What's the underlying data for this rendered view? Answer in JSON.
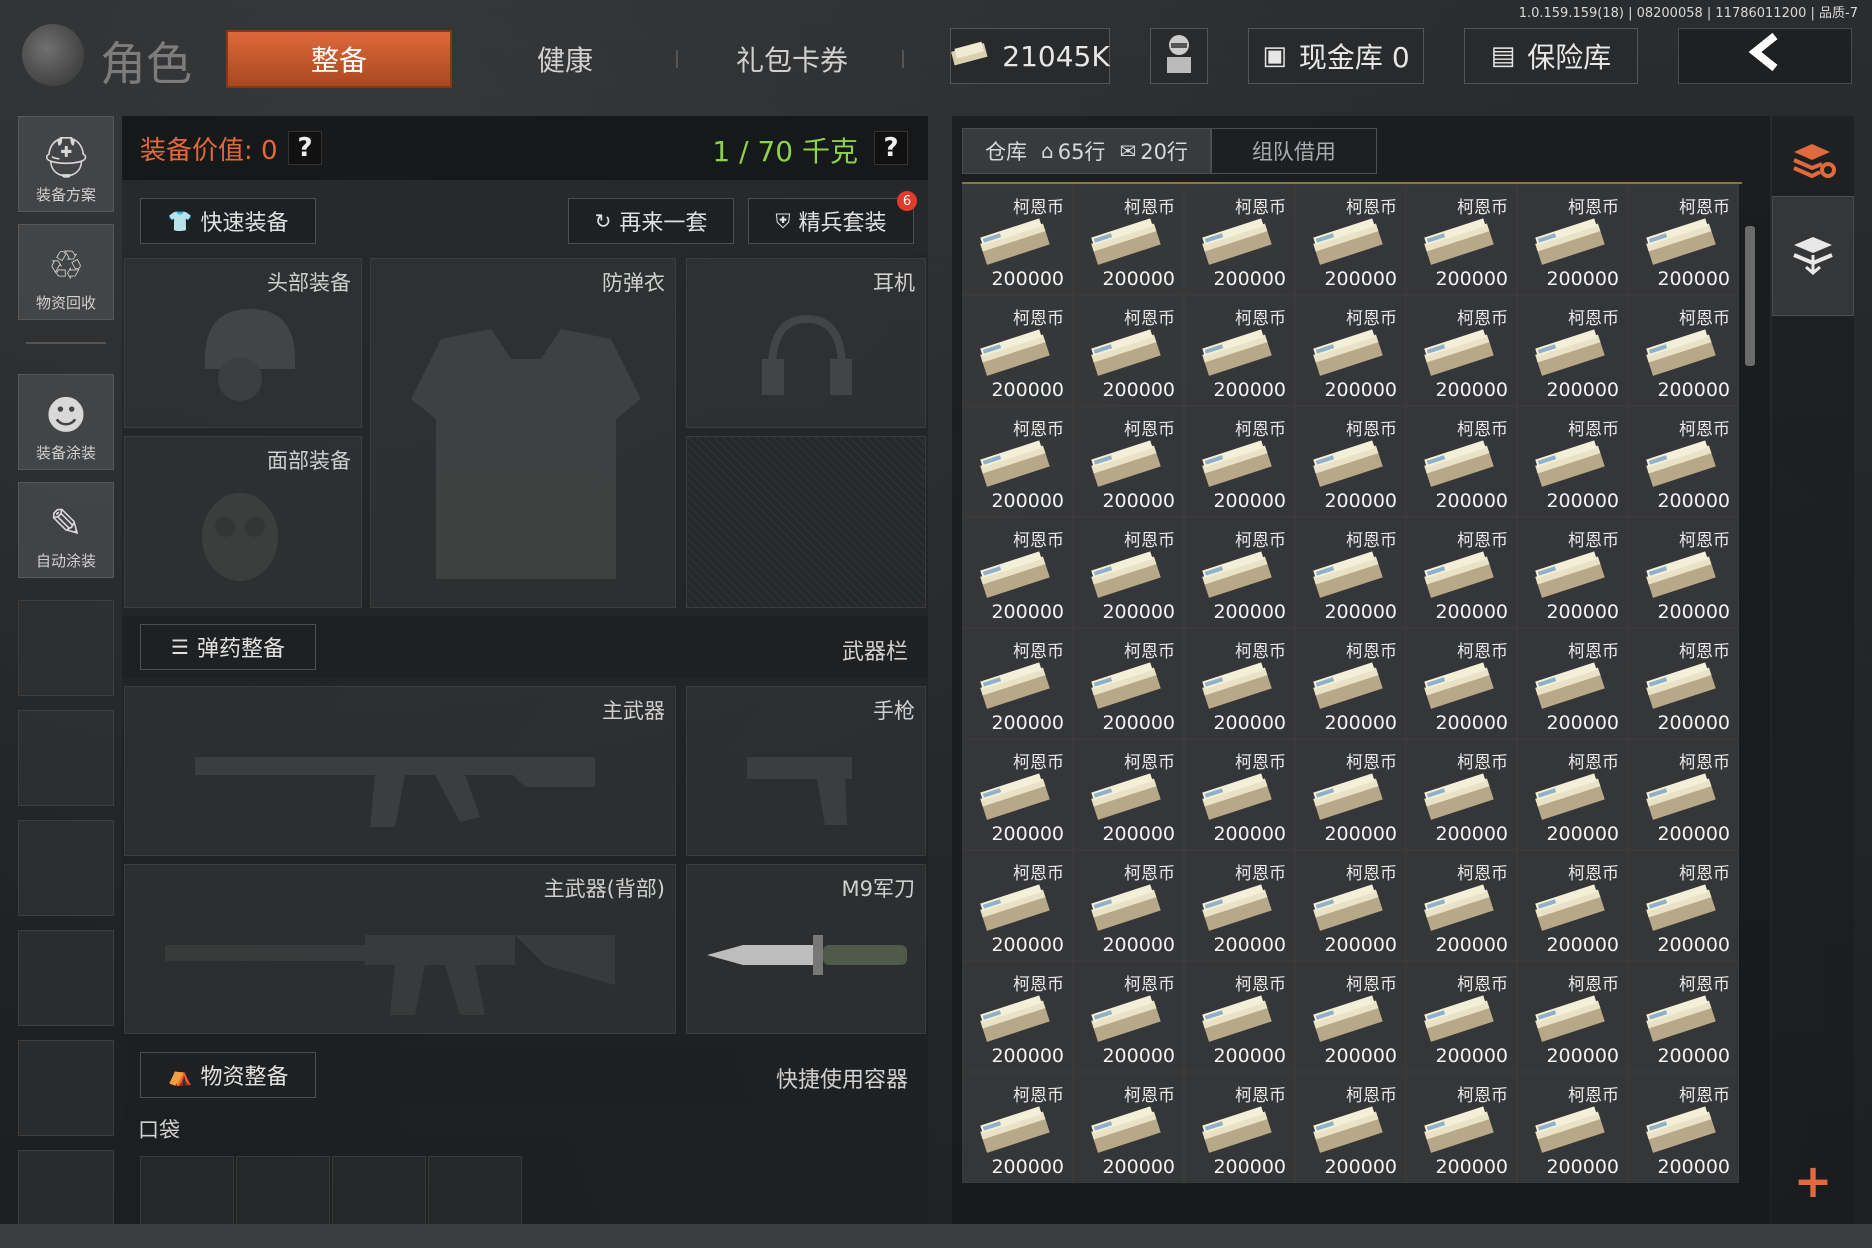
{
  "version_info": "1.0.159.159(18) | 08200058 | 11786011200 | 品质-7",
  "header": {
    "title": "角色",
    "tabs": [
      {
        "label": "整备",
        "active": true
      },
      {
        "label": "健康",
        "active": false
      },
      {
        "label": "礼包卡券",
        "active": false
      }
    ],
    "currency_amount": "21045K",
    "cash_vault_label": "现金库 0",
    "safe_label": "保险库"
  },
  "sidebar": {
    "items": [
      {
        "label": "装备方案",
        "icon": "loadout-icon"
      },
      {
        "label": "物资回收",
        "icon": "recycle-icon"
      },
      {
        "label": "装备涂装",
        "icon": "skin-icon"
      },
      {
        "label": "自动涂装",
        "icon": "auto-paint-icon"
      }
    ]
  },
  "equipment": {
    "value_label": "装备价值: 0",
    "help_symbol": "?",
    "weight": "1 / 70 千克",
    "buttons": {
      "quick_equip": "快速装备",
      "another_set": "再来一套",
      "elite_set": "精兵套装",
      "elite_badge": "6"
    },
    "slots": {
      "head": "头部装备",
      "armor": "防弹衣",
      "headset": "耳机",
      "face": "面部装备"
    },
    "ammo_section": {
      "button": "弹药整备",
      "title": "武器栏"
    },
    "weapons": {
      "primary": "主武器",
      "pistol": "手枪",
      "primary_back": "主武器(背部)",
      "knife": "M9军刀"
    },
    "supply_section": {
      "button": "物资整备",
      "title": "快捷使用容器"
    },
    "pocket_label": "口袋"
  },
  "warehouse": {
    "tab_main": "仓库",
    "rows_home": "65行",
    "rows_extra": "20行",
    "tab_team": "组队借用",
    "item_name": "柯恩币",
    "item_amount": "200000",
    "columns": 7,
    "rows": 9
  },
  "right_strip": {
    "plus": "+"
  },
  "colors": {
    "accent_orange": "#e06a3b",
    "weight_green": "#8fd14a",
    "value_orange": "#e5673a"
  }
}
